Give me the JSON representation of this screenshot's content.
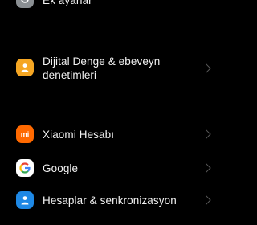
{
  "settings": {
    "items": [
      {
        "label": "Ek ayarlar",
        "icon": "more-settings-icon",
        "color": "#8a8f93"
      },
      {
        "label": "Dijital Denge & ebeveyn denetimleri",
        "icon": "digital-wellbeing-icon",
        "color": "#f5a623"
      },
      {
        "label": "Xiaomi Hesabı",
        "icon": "xiaomi-logo-icon",
        "color": "#ff6900"
      },
      {
        "label": "Google",
        "icon": "google-logo-icon",
        "color": "#ffffff"
      },
      {
        "label": "Hesaplar & senkronizasyon",
        "icon": "accounts-sync-icon",
        "color": "#1e88e5"
      }
    ],
    "xiaomi_icon_text": "mi"
  }
}
